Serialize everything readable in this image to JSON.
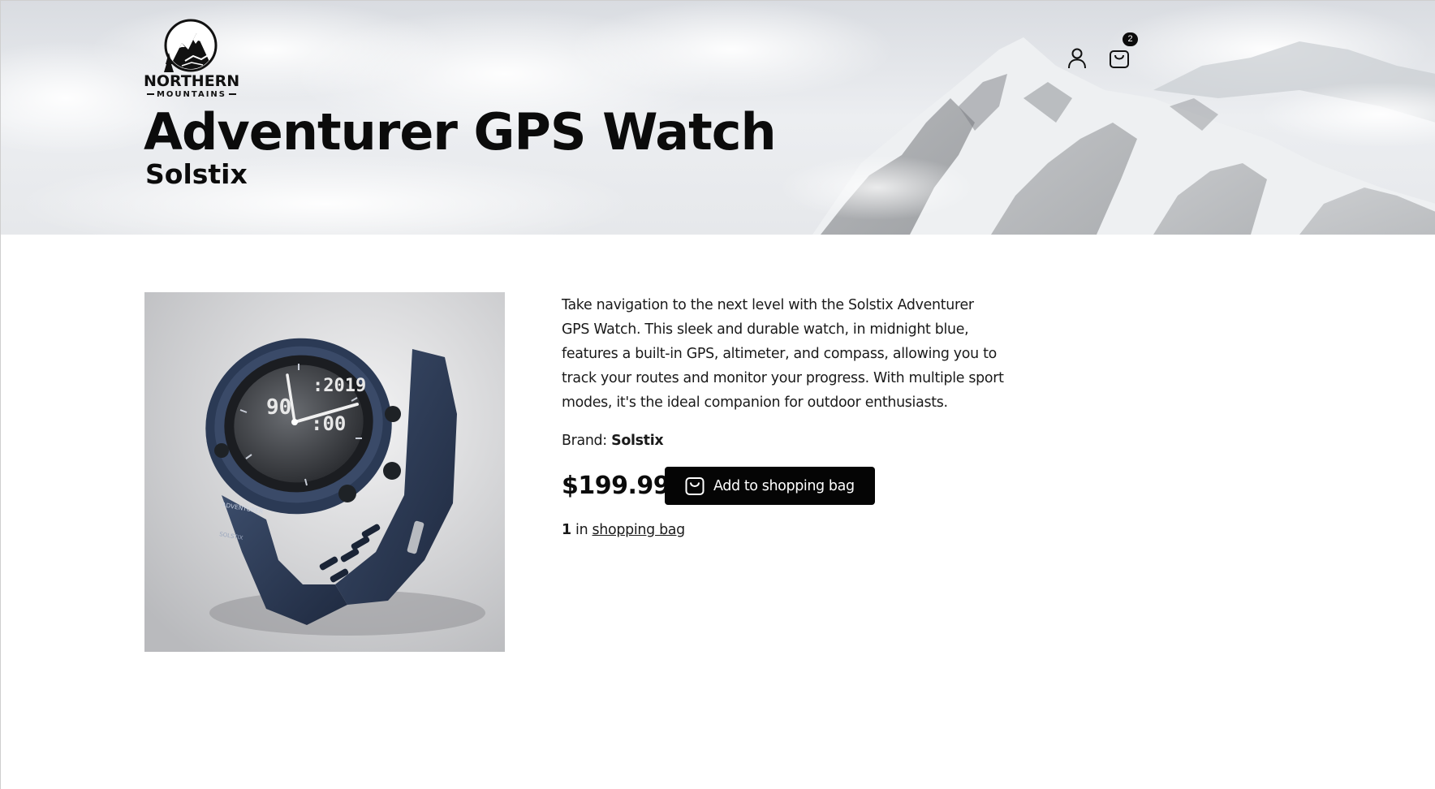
{
  "header": {
    "logo": {
      "line1": "NORTHERN",
      "line2": "MOUNTAINS"
    },
    "title": "Adventurer GPS Watch",
    "subtitle": "Solstix",
    "account_icon": "user-icon",
    "cart_icon": "shopping-bag-icon",
    "cart_count": "2"
  },
  "product": {
    "image_alt": "Solstix Adventurer GPS Watch in midnight blue",
    "description": "Take navigation to the next level with the Solstix Adventurer GPS Watch. This sleek and durable watch, in midnight blue, features a built-in GPS, altimeter, and compass, allowing you to track your routes and monitor your progress. With multiple sport modes, it's the ideal companion for outdoor enthusiasts.",
    "brand_label": "Brand:",
    "brand": "Solstix",
    "price": "$199.99",
    "add_button": "Add to shopping bag",
    "in_bag_count": "1",
    "in_bag_text": "in",
    "in_bag_link": "shopping bag"
  },
  "colors": {
    "primary": "#050505",
    "watch_blue": "#2b3a55",
    "background": "#ffffff"
  }
}
